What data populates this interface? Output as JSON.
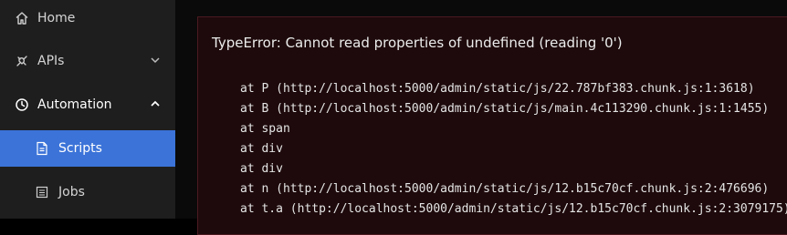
{
  "sidebar": {
    "items": [
      {
        "label": "Home",
        "icon": "home-icon"
      },
      {
        "label": "APIs",
        "icon": "plug-icon",
        "expandable": true,
        "expanded": false
      },
      {
        "label": "Automation",
        "icon": "clock-icon",
        "expandable": true,
        "expanded": true
      },
      {
        "label": "Scripts",
        "icon": "document-icon",
        "active": true
      },
      {
        "label": "Jobs",
        "icon": "list-icon"
      }
    ]
  },
  "error": {
    "title": "TypeError: Cannot read properties of undefined (reading '0')",
    "stack": [
      "at P (http://localhost:5000/admin/static/js/22.787bf383.chunk.js:1:3618)",
      "at B (http://localhost:5000/admin/static/js/main.4c113290.chunk.js:1:1455)",
      "at span",
      "at div",
      "at div",
      "at n (http://localhost:5000/admin/static/js/12.b15c70cf.chunk.js:2:476696)",
      "at t.a (http://localhost:5000/admin/static/js/12.b15c70cf.chunk.js:2:3079175)"
    ]
  },
  "colors": {
    "sidebar_bg": "#1e1e1e",
    "active_bg": "#3b73d8",
    "error_bg": "#1e0a0c",
    "error_border": "#4a1a20"
  }
}
